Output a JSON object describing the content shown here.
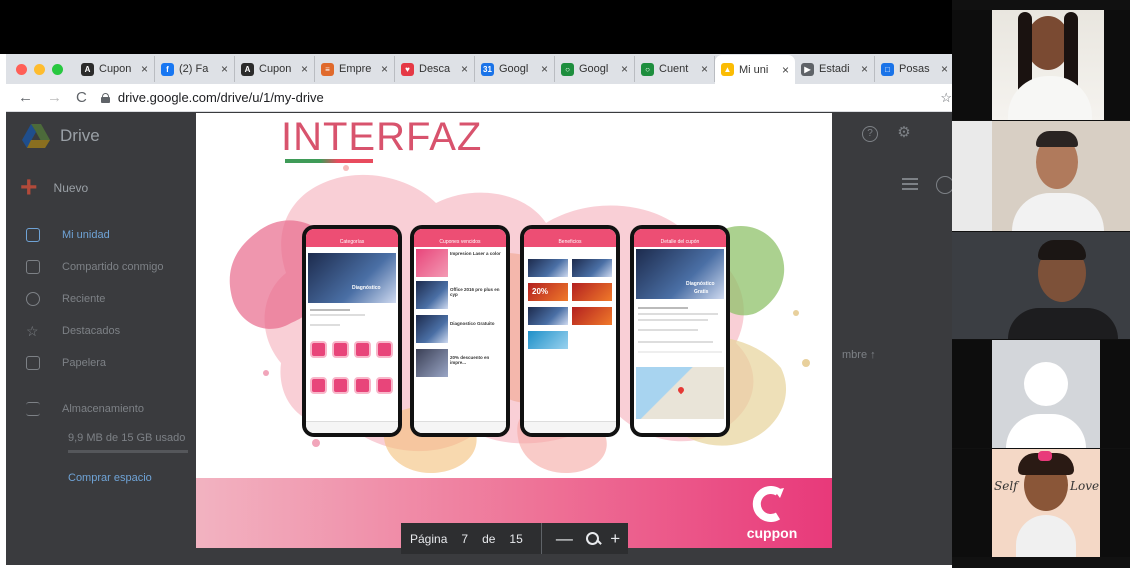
{
  "browser": {
    "tabs": [
      {
        "title": "Cupon",
        "fav_color": "#2b2b2b",
        "fav_glyph": "A",
        "active": false
      },
      {
        "title": "(2) Fa",
        "fav_color": "#1877f2",
        "fav_glyph": "f",
        "active": false
      },
      {
        "title": "Cupon",
        "fav_color": "#2b2b2b",
        "fav_glyph": "A",
        "active": false
      },
      {
        "title": "Empre",
        "fav_color": "#e06a2c",
        "fav_glyph": "≡",
        "active": false
      },
      {
        "title": "Desca",
        "fav_color": "#e53945",
        "fav_glyph": "♥",
        "active": false
      },
      {
        "title": "Googl",
        "fav_color": "#1a73e8",
        "fav_glyph": "31",
        "active": false
      },
      {
        "title": "Googl",
        "fav_color": "#1e8e3e",
        "fav_glyph": "○",
        "active": false
      },
      {
        "title": "Cuent",
        "fav_color": "#1e8e3e",
        "fav_glyph": "○",
        "active": false
      },
      {
        "title": "Mi uni",
        "fav_color": "#fbbc04",
        "fav_glyph": "▲",
        "active": true
      },
      {
        "title": "Estadi",
        "fav_color": "#5f6368",
        "fav_glyph": "▶",
        "active": false
      },
      {
        "title": "Posas",
        "fav_color": "#1a73e8",
        "fav_glyph": "□",
        "active": false
      }
    ],
    "tab_close": "×",
    "url": "drive.google.com/drive/u/1/my-drive",
    "back": "←",
    "forward": "→",
    "reload": "C",
    "star": "☆"
  },
  "drive": {
    "title": "Drive",
    "new_label": "Nuevo",
    "sidebar": [
      {
        "label": "Mi unidad",
        "active": true
      },
      {
        "label": "Compartido conmigo",
        "active": false
      },
      {
        "label": "Reciente",
        "active": false
      },
      {
        "label": "Destacados",
        "active": false
      },
      {
        "label": "Papelera",
        "active": false
      },
      {
        "label": "Almacenamiento",
        "active": false
      }
    ],
    "storage_text": "9,9 MB de 15 GB usado",
    "buy_label": "Comprar espacio",
    "help_glyph": "?",
    "settings_glyph": "⚙",
    "sort_label": "mbre  ↑"
  },
  "slide": {
    "title": "INTERFAZ",
    "brand": "cuppon",
    "phones": [
      {
        "header": "Categorías"
      },
      {
        "header": "Cupones vencidos"
      },
      {
        "header": "Beneficios"
      },
      {
        "header": "Detalle del cupón"
      }
    ],
    "phone_texts": {
      "p1_label": "Diagnóstico",
      "p2_items": [
        "Impresion Laser a color",
        "Office 2016 pro plus en cyp",
        "Diagnostico Gratuito",
        "20% descuento en impre..."
      ],
      "p3_badge": "20%",
      "p4_label": "Diagnóstico",
      "p4_sub": "Gratis"
    }
  },
  "pdf_toolbar": {
    "page_label": "Página",
    "current_page": "7",
    "of_label": "de",
    "total_pages": "15",
    "zoom_out": "—",
    "zoom_in": "+"
  },
  "video_call": {
    "tile_5_text_left": "Self",
    "tile_5_text_right": "Love"
  }
}
